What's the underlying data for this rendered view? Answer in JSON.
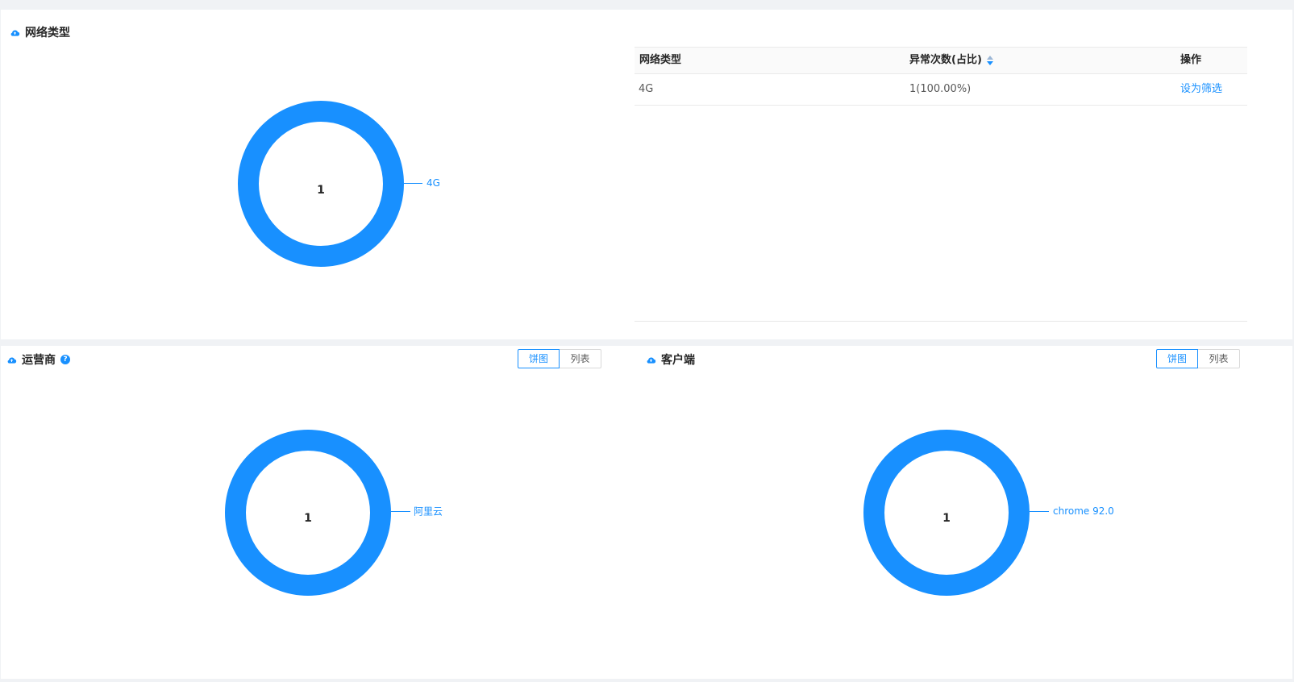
{
  "network_panel": {
    "title": "网络类型",
    "icon": "cloud-icon",
    "donut": {
      "center_value": "1",
      "slice_label": "4G",
      "color": "#1890ff"
    },
    "table": {
      "columns": [
        "网络类型",
        "异常次数(占比)",
        "操作"
      ],
      "rows": [
        {
          "network_type": "4G",
          "count": "1(100.00%)",
          "action": "设为筛选"
        }
      ]
    }
  },
  "carrier_panel": {
    "title": "运营商",
    "help_icon_text": "?",
    "toggle": {
      "pie": "饼图",
      "list": "列表",
      "selected": "饼图"
    },
    "donut": {
      "center_value": "1",
      "slice_label": "阿里云",
      "color": "#1890ff"
    }
  },
  "client_panel": {
    "title": "客户端",
    "toggle": {
      "pie": "饼图",
      "list": "列表",
      "selected": "饼图"
    },
    "donut": {
      "center_value": "1",
      "slice_label": "chrome 92.0",
      "color": "#1890ff"
    }
  },
  "chart_data": [
    {
      "type": "pie",
      "categories": [
        "4G"
      ],
      "values": [
        1
      ],
      "title": "网络类型"
    },
    {
      "type": "pie",
      "categories": [
        "阿里云"
      ],
      "values": [
        1
      ],
      "title": "运营商"
    },
    {
      "type": "pie",
      "categories": [
        "chrome 92.0"
      ],
      "values": [
        1
      ],
      "title": "客户端"
    }
  ]
}
